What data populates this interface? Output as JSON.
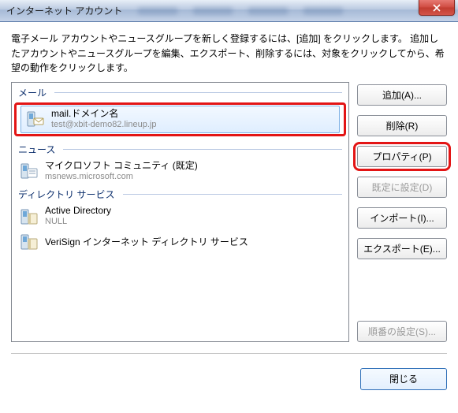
{
  "window": {
    "title": "インターネット アカウント",
    "close": "×"
  },
  "description": "電子メール アカウントやニュースグループを新しく登録するには、[追加] をクリックします。 追加したアカウントやニュースグループを編集、エクスポート、削除するには、対象をクリックしてから、希望の動作をクリックします。",
  "sections": {
    "mail": {
      "label": "メール",
      "items": [
        {
          "title": "mail.ドメイン名",
          "sub": "test@xbit-demo82.lineup.jp"
        }
      ]
    },
    "news": {
      "label": "ニュース",
      "items": [
        {
          "title": "マイクロソフト コミュニティ (既定)",
          "sub": "msnews.microsoft.com"
        }
      ]
    },
    "dir": {
      "label": "ディレクトリ サービス",
      "items": [
        {
          "title": "Active Directory",
          "sub": "NULL"
        },
        {
          "title": "VeriSign インターネット ディレクトリ サービス",
          "sub": ""
        }
      ]
    }
  },
  "buttons": {
    "add": "追加(A)...",
    "remove": "削除(R)",
    "properties": "プロパティ(P)",
    "setdefault": "既定に設定(D)",
    "import": "インポート(I)...",
    "export": "エクスポート(E)...",
    "order": "順番の設定(S)...",
    "close": "閉じる"
  }
}
